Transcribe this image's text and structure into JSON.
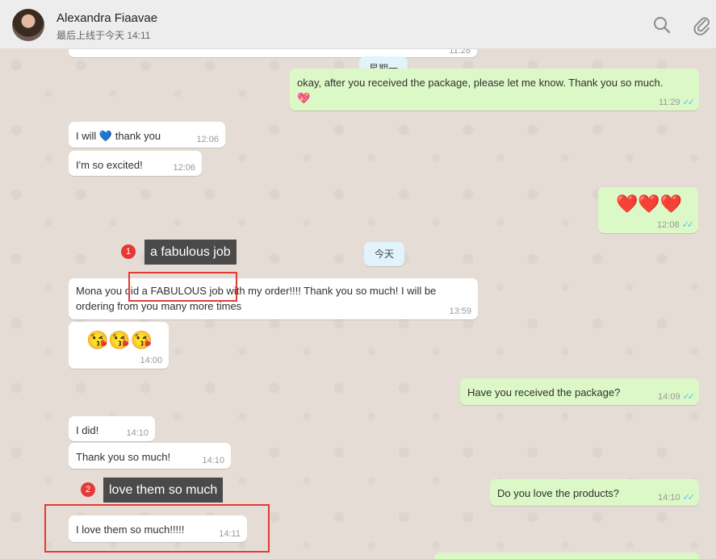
{
  "header": {
    "contact_name": "Alexandra Fiaavae",
    "last_seen": "最后上线于今天 14:11"
  },
  "chat": {
    "top_partial_time": "11:28",
    "date_chip_monday": "星期一",
    "date_chip_today": "今天",
    "messages": [
      {
        "dir": "out",
        "text": "okay, after you received the package, please let me know. Thank you so much.",
        "emoji": "💖",
        "time": "11:29"
      },
      {
        "dir": "in",
        "text_before": "I will",
        "emoji": "💙",
        "text_after": "thank you",
        "time": "12:06"
      },
      {
        "dir": "in",
        "text": "I'm so excited!",
        "time": "12:06"
      },
      {
        "dir": "out",
        "emoji": "❤️❤️❤️",
        "time": "12:08"
      },
      {
        "dir": "in",
        "text_line1": "Mona you did a FABULOUS job with my order!!!! Thank you so much! I will be",
        "text_line2": "ordering from you many more times",
        "time": "13:59"
      },
      {
        "dir": "in",
        "emoji": "😘😘😘",
        "time": "14:00"
      },
      {
        "dir": "out",
        "text": "Have you received the package?",
        "time": "14:09"
      },
      {
        "dir": "in",
        "text": "I did!",
        "time": "14:10"
      },
      {
        "dir": "in",
        "text": "Thank you so much!",
        "time": "14:10"
      },
      {
        "dir": "out",
        "text": "Do you love the products?",
        "time": "14:10"
      },
      {
        "dir": "in",
        "text": "I love them so much!!!!!",
        "time": "14:11"
      }
    ]
  },
  "annotations": [
    {
      "number": "1",
      "label": "a fabulous job"
    },
    {
      "number": "2",
      "label": "love them so much"
    }
  ],
  "colors": {
    "incoming": "#ffffff",
    "outgoing": "#dcf8c6",
    "chat_bg": "#e5ddd5",
    "annotation_red": "#e53935",
    "read_ticks": "#4fc3f7"
  },
  "icons": [
    "search-icon",
    "attach-icon",
    "read-receipt-icon"
  ]
}
